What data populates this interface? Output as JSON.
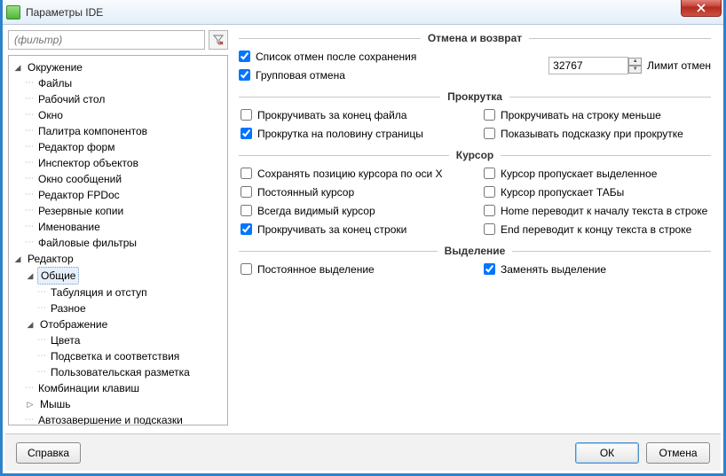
{
  "window": {
    "title": "Параметры IDE"
  },
  "filter": {
    "placeholder": "(фильтр)"
  },
  "tree": {
    "environment": {
      "label": "Окружение",
      "items": [
        "Файлы",
        "Рабочий стол",
        "Окно",
        "Палитра компонентов",
        "Редактор форм",
        "Инспектор объектов",
        "Окно сообщений",
        "Редактор FPDoc",
        "Резервные копии",
        "Именование",
        "Файловые фильтры"
      ]
    },
    "editor": {
      "label": "Редактор",
      "general": {
        "label": "Общие",
        "items": [
          "Табуляция и отступ",
          "Разное"
        ]
      },
      "display": {
        "label": "Отображение",
        "items": [
          "Цвета",
          "Подсветка и соответствия",
          "Пользовательская разметка"
        ]
      },
      "keys": "Комбинации клавиш",
      "mouse": "Мышь",
      "autocomplete": "Автозавершение и подсказки"
    }
  },
  "groups": {
    "undo": {
      "title": "Отмена и возврат",
      "undo_after_save": "Список отмен после сохранения",
      "group_undo": "Групповая отмена",
      "limit_value": "32767",
      "limit_label": "Лимит отмен"
    },
    "scroll": {
      "title": "Прокрутка",
      "past_eof": "Прокручивать за конец файла",
      "half_page": "Прокрутка на половину страницы",
      "by_one_less": "Прокручивать на строку меньше",
      "show_hint": "Показывать подсказку при прокрутке"
    },
    "cursor": {
      "title": "Курсор",
      "keep_x": "Сохранять позицию курсора по оси X",
      "persistent": "Постоянный курсор",
      "always_visible": "Всегда видимый курсор",
      "past_eol": "Прокручивать за конец строки",
      "skip_selection": "Курсор пропускает выделенное",
      "skip_tabs": "Курсор пропускает ТАБы",
      "home_begin": "Home переводит к началу текста в строке",
      "end_eol": "End переводит к концу текста в строке"
    },
    "selection": {
      "title": "Выделение",
      "persistent": "Постоянное выделение",
      "overwrite": "Заменять выделение"
    }
  },
  "buttons": {
    "help": "Справка",
    "ok": "ОК",
    "cancel": "Отмена"
  }
}
